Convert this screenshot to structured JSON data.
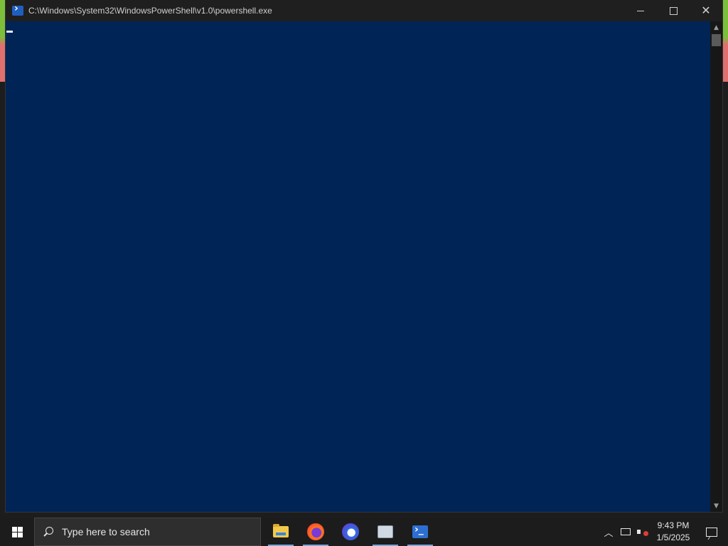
{
  "window": {
    "title": "C:\\Windows\\System32\\WindowsPowerShell\\v1.0\\powershell.exe",
    "icon": "powershell-icon",
    "controls": [
      "minimize-icon",
      "maximize-icon",
      "close-icon"
    ],
    "background": "#012456"
  },
  "console": {
    "text": ""
  },
  "taskbar": {
    "search_placeholder": "Type here to search",
    "apps": [
      {
        "name": "File Explorer",
        "icon": "folder-icon",
        "active": true
      },
      {
        "name": "Firefox",
        "icon": "firefox-icon",
        "active": true
      },
      {
        "name": "Firefox Developer Edition",
        "icon": "firefox-dev-icon",
        "active": false
      },
      {
        "name": "Remote Desktop",
        "icon": "remote-desktop-icon",
        "active": true
      },
      {
        "name": "Windows PowerShell",
        "icon": "powershell-icon",
        "active": true
      }
    ],
    "tray": {
      "time": "9:43 PM",
      "date": "1/5/2025"
    }
  }
}
